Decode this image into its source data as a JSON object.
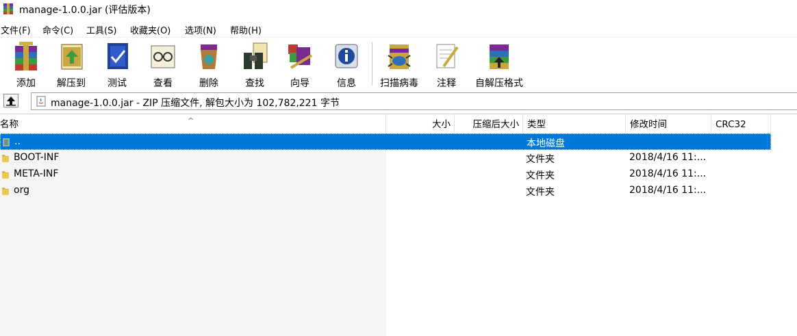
{
  "window": {
    "title": "manage-1.0.0.jar (评估版本)"
  },
  "menu": [
    "文件(F)",
    "命令(C)",
    "工具(S)",
    "收藏夹(O)",
    "选项(N)",
    "帮助(H)"
  ],
  "toolbar": [
    {
      "label": "添加",
      "icon": "add-archive-icon"
    },
    {
      "label": "解压到",
      "icon": "extract-to-icon"
    },
    {
      "label": "测试",
      "icon": "test-icon"
    },
    {
      "label": "查看",
      "icon": "view-icon"
    },
    {
      "label": "删除",
      "icon": "delete-icon"
    },
    {
      "label": "查找",
      "icon": "find-icon"
    },
    {
      "label": "向导",
      "icon": "wizard-icon"
    },
    {
      "label": "信息",
      "icon": "info-icon"
    },
    {
      "label": "扫描病毒",
      "icon": "virus-scan-icon"
    },
    {
      "label": "注释",
      "icon": "comment-icon"
    },
    {
      "label": "自解压格式",
      "icon": "sfx-icon"
    }
  ],
  "path": {
    "text": "manage-1.0.0.jar - ZIP 压缩文件, 解包大小为 102,782,221 字节"
  },
  "columns": {
    "name": "名称",
    "size": "大小",
    "packed": "压缩后大小",
    "type": "类型",
    "modified": "修改时间",
    "crc": "CRC32"
  },
  "files": [
    {
      "name": "..",
      "type": "本地磁盘",
      "modified": "",
      "selected": true
    },
    {
      "name": "BOOT-INF",
      "type": "文件夹",
      "modified": "2018/4/16 11:..."
    },
    {
      "name": "META-INF",
      "type": "文件夹",
      "modified": "2018/4/16 11:..."
    },
    {
      "name": "org",
      "type": "文件夹",
      "modified": "2018/4/16 11:..."
    }
  ],
  "colors": {
    "selection": "#0078d7",
    "folder": "#e8b53a"
  }
}
